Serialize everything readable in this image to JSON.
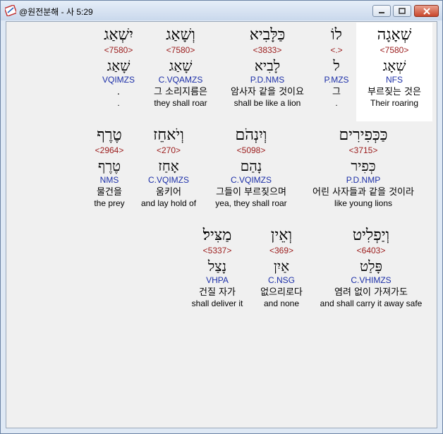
{
  "window": {
    "title": "@원전분해 - 사 5:29",
    "app_icon": "app-icon",
    "buttons": [
      "minimize",
      "maximize",
      "close"
    ]
  },
  "rows": [
    {
      "words": [
        {
          "heb": "שְׁאָגָה",
          "num": "<7580>",
          "lemma": "שְׁאָג",
          "morph": "NFS",
          "ko": "부르짖는 것은",
          "en": "Their roaring",
          "highlight": true
        },
        {
          "heb": "לוֹ",
          "num": "<.>",
          "lemma": "ל",
          "morph": "P.MZS",
          "ko": "그",
          "en": "."
        },
        {
          "heb": "כַּלָּבִיא",
          "num": "<3833>",
          "lemma": "לָבִיא",
          "morph": "P.D.NMS",
          "ko": "암사자 같을 것이요",
          "en": "shall be like a lion"
        },
        {
          "heb": "וְשָׁאַג",
          "num": "<7580>",
          "lemma": "שָׁאַג",
          "morph": "C.VQAMZS",
          "ko": "그 소리지름은",
          "en": "they shall roar"
        },
        {
          "heb": "יִשְׁאַג",
          "num": "<7580>",
          "lemma": "שָׁאַג",
          "morph": "VQIMZS",
          "ko": ".",
          "en": "."
        }
      ]
    },
    {
      "words": [
        {
          "heb": "כַּכְּפִירִים",
          "num": "<3715>",
          "lemma": "כְּפִיר",
          "morph": "P.D.NMP",
          "ko": "어린 사자들과 같을 것이라",
          "en": "like young lions"
        },
        {
          "heb": "וְיִנְהֹם",
          "num": "<5098>",
          "lemma": "נָהַם",
          "morph": "C.VQIMZS",
          "ko": "그들이 부르짖으며",
          "en": "yea, they shall roar"
        },
        {
          "heb": "וְיֹאחֵז",
          "num": "<270>",
          "lemma": "אָחַז",
          "morph": "C.VQIMZS",
          "ko": "움키어",
          "en": "and lay hold of"
        },
        {
          "heb": "טֶרֶף",
          "num": "<2964>",
          "lemma": "טֶרֶף",
          "morph": "NMS",
          "ko": "물건을",
          "en": "the prey"
        }
      ]
    },
    {
      "words": [
        {
          "heb": "וְיַפְלִיט",
          "num": "<6403>",
          "lemma": "פָּלַט",
          "morph": "C.VHIMZS",
          "ko": "염려 없이 가져가도",
          "en": "and shall carry it away safe"
        },
        {
          "heb": "וְאֵין",
          "num": "<369>",
          "lemma": "אַיִן",
          "morph": "C.NSG",
          "ko": "없으리로다",
          "en": "and none"
        },
        {
          "heb": "מַצִּיל׃",
          "num": "<5337>",
          "lemma": "נָצַל",
          "morph": "VHPA",
          "ko": "건질 자가",
          "en": "shall deliver it"
        }
      ]
    }
  ]
}
